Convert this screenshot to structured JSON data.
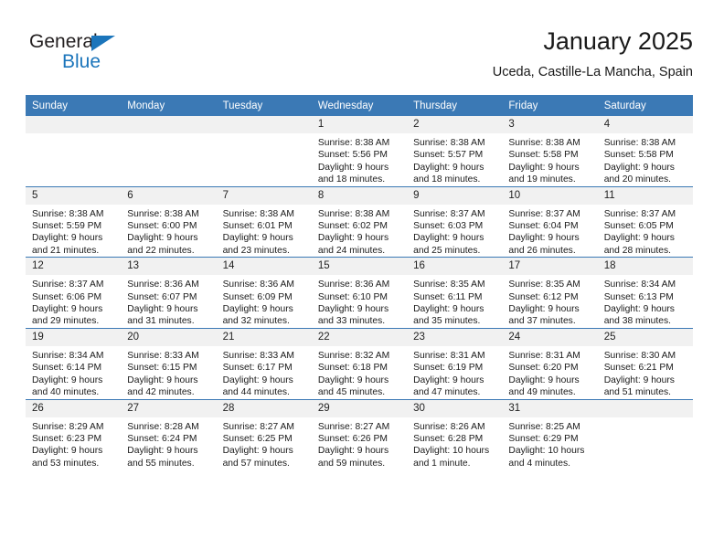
{
  "brand": {
    "word_one": "General",
    "word_two": "Blue",
    "triangle_color": "#1b75bb"
  },
  "header": {
    "title": "January 2025",
    "subtitle": "Uceda, Castille-La Mancha, Spain",
    "accent_color": "#3b79b5"
  },
  "calendar": {
    "weekday_headers": [
      "Sunday",
      "Monday",
      "Tuesday",
      "Wednesday",
      "Thursday",
      "Friday",
      "Saturday"
    ],
    "weeks": [
      [
        {
          "day": "",
          "lines": []
        },
        {
          "day": "",
          "lines": []
        },
        {
          "day": "",
          "lines": []
        },
        {
          "day": "1",
          "lines": [
            "Sunrise: 8:38 AM",
            "Sunset: 5:56 PM",
            "Daylight: 9 hours",
            "and 18 minutes."
          ]
        },
        {
          "day": "2",
          "lines": [
            "Sunrise: 8:38 AM",
            "Sunset: 5:57 PM",
            "Daylight: 9 hours",
            "and 18 minutes."
          ]
        },
        {
          "day": "3",
          "lines": [
            "Sunrise: 8:38 AM",
            "Sunset: 5:58 PM",
            "Daylight: 9 hours",
            "and 19 minutes."
          ]
        },
        {
          "day": "4",
          "lines": [
            "Sunrise: 8:38 AM",
            "Sunset: 5:58 PM",
            "Daylight: 9 hours",
            "and 20 minutes."
          ]
        }
      ],
      [
        {
          "day": "5",
          "lines": [
            "Sunrise: 8:38 AM",
            "Sunset: 5:59 PM",
            "Daylight: 9 hours",
            "and 21 minutes."
          ]
        },
        {
          "day": "6",
          "lines": [
            "Sunrise: 8:38 AM",
            "Sunset: 6:00 PM",
            "Daylight: 9 hours",
            "and 22 minutes."
          ]
        },
        {
          "day": "7",
          "lines": [
            "Sunrise: 8:38 AM",
            "Sunset: 6:01 PM",
            "Daylight: 9 hours",
            "and 23 minutes."
          ]
        },
        {
          "day": "8",
          "lines": [
            "Sunrise: 8:38 AM",
            "Sunset: 6:02 PM",
            "Daylight: 9 hours",
            "and 24 minutes."
          ]
        },
        {
          "day": "9",
          "lines": [
            "Sunrise: 8:37 AM",
            "Sunset: 6:03 PM",
            "Daylight: 9 hours",
            "and 25 minutes."
          ]
        },
        {
          "day": "10",
          "lines": [
            "Sunrise: 8:37 AM",
            "Sunset: 6:04 PM",
            "Daylight: 9 hours",
            "and 26 minutes."
          ]
        },
        {
          "day": "11",
          "lines": [
            "Sunrise: 8:37 AM",
            "Sunset: 6:05 PM",
            "Daylight: 9 hours",
            "and 28 minutes."
          ]
        }
      ],
      [
        {
          "day": "12",
          "lines": [
            "Sunrise: 8:37 AM",
            "Sunset: 6:06 PM",
            "Daylight: 9 hours",
            "and 29 minutes."
          ]
        },
        {
          "day": "13",
          "lines": [
            "Sunrise: 8:36 AM",
            "Sunset: 6:07 PM",
            "Daylight: 9 hours",
            "and 31 minutes."
          ]
        },
        {
          "day": "14",
          "lines": [
            "Sunrise: 8:36 AM",
            "Sunset: 6:09 PM",
            "Daylight: 9 hours",
            "and 32 minutes."
          ]
        },
        {
          "day": "15",
          "lines": [
            "Sunrise: 8:36 AM",
            "Sunset: 6:10 PM",
            "Daylight: 9 hours",
            "and 33 minutes."
          ]
        },
        {
          "day": "16",
          "lines": [
            "Sunrise: 8:35 AM",
            "Sunset: 6:11 PM",
            "Daylight: 9 hours",
            "and 35 minutes."
          ]
        },
        {
          "day": "17",
          "lines": [
            "Sunrise: 8:35 AM",
            "Sunset: 6:12 PM",
            "Daylight: 9 hours",
            "and 37 minutes."
          ]
        },
        {
          "day": "18",
          "lines": [
            "Sunrise: 8:34 AM",
            "Sunset: 6:13 PM",
            "Daylight: 9 hours",
            "and 38 minutes."
          ]
        }
      ],
      [
        {
          "day": "19",
          "lines": [
            "Sunrise: 8:34 AM",
            "Sunset: 6:14 PM",
            "Daylight: 9 hours",
            "and 40 minutes."
          ]
        },
        {
          "day": "20",
          "lines": [
            "Sunrise: 8:33 AM",
            "Sunset: 6:15 PM",
            "Daylight: 9 hours",
            "and 42 minutes."
          ]
        },
        {
          "day": "21",
          "lines": [
            "Sunrise: 8:33 AM",
            "Sunset: 6:17 PM",
            "Daylight: 9 hours",
            "and 44 minutes."
          ]
        },
        {
          "day": "22",
          "lines": [
            "Sunrise: 8:32 AM",
            "Sunset: 6:18 PM",
            "Daylight: 9 hours",
            "and 45 minutes."
          ]
        },
        {
          "day": "23",
          "lines": [
            "Sunrise: 8:31 AM",
            "Sunset: 6:19 PM",
            "Daylight: 9 hours",
            "and 47 minutes."
          ]
        },
        {
          "day": "24",
          "lines": [
            "Sunrise: 8:31 AM",
            "Sunset: 6:20 PM",
            "Daylight: 9 hours",
            "and 49 minutes."
          ]
        },
        {
          "day": "25",
          "lines": [
            "Sunrise: 8:30 AM",
            "Sunset: 6:21 PM",
            "Daylight: 9 hours",
            "and 51 minutes."
          ]
        }
      ],
      [
        {
          "day": "26",
          "lines": [
            "Sunrise: 8:29 AM",
            "Sunset: 6:23 PM",
            "Daylight: 9 hours",
            "and 53 minutes."
          ]
        },
        {
          "day": "27",
          "lines": [
            "Sunrise: 8:28 AM",
            "Sunset: 6:24 PM",
            "Daylight: 9 hours",
            "and 55 minutes."
          ]
        },
        {
          "day": "28",
          "lines": [
            "Sunrise: 8:27 AM",
            "Sunset: 6:25 PM",
            "Daylight: 9 hours",
            "and 57 minutes."
          ]
        },
        {
          "day": "29",
          "lines": [
            "Sunrise: 8:27 AM",
            "Sunset: 6:26 PM",
            "Daylight: 9 hours",
            "and 59 minutes."
          ]
        },
        {
          "day": "30",
          "lines": [
            "Sunrise: 8:26 AM",
            "Sunset: 6:28 PM",
            "Daylight: 10 hours",
            "and 1 minute."
          ]
        },
        {
          "day": "31",
          "lines": [
            "Sunrise: 8:25 AM",
            "Sunset: 6:29 PM",
            "Daylight: 10 hours",
            "and 4 minutes."
          ]
        },
        {
          "day": "",
          "lines": []
        }
      ]
    ]
  }
}
